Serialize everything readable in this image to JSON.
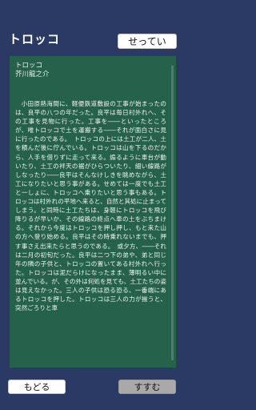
{
  "header": {
    "title": "トロッコ",
    "settings_label": "せってい"
  },
  "story": {
    "title": "トロッコ",
    "author": "芥川龍之介",
    "body": "小田原熱海間に、軽便鉄道敷設の工事が始まったのは、良平の八つの年だった。良平は毎日村外れへ、その工事を見物に行った。工事を――といったところが、唯トロッコで土を運搬する――それが面白さに見に行ったのである。　トロッコの上には土工が二人、土を積んだ後に佇んでいる。トロッコは山を下るのだから、人手を借りずに走って来る。煽るように車台が動いたり、土工の袢天の裾がひらついたり、細い線路がしなったり――良平はそんなけしきを眺めながら、土工になりたいと思う事がある。せめては一度でも土工と一しょに、トロッコへ乗りたいと思う事もある。トロッコは村外れの平地へ来ると、自然と其処に止まってしまう。と同時に土工たちは、身軽にトロッコを飛び降りるが早いか、その線路の終点へ車の土をぶちまける。それから今度はトロッコを押し押し、もと来た山の方へ登り始める。良平はその時乗れないまでも、押す事さえ出来たらと思うのである。　或夕方、――それは二月の初旬だった。良平は二つ下の弟や、弟と同じ年の隣の子供と、トロッコの置いてある村外れへ行った。トロッコは泥だらけになったまま、薄明るい中に並んでいる。が、その外は何処を見ても、土工たちの姿は見えなかった。三人の子供は恐る恐る、一番端にあるトロッコを押した。トロッコは三人の力が揃うと、突然ごろりと車"
  },
  "footer": {
    "back_label": "もどる",
    "next_label": "すすむ"
  },
  "colors": {
    "background": "#2a3a65",
    "reader": "#25614b",
    "next_button": "#a9a9a9"
  }
}
